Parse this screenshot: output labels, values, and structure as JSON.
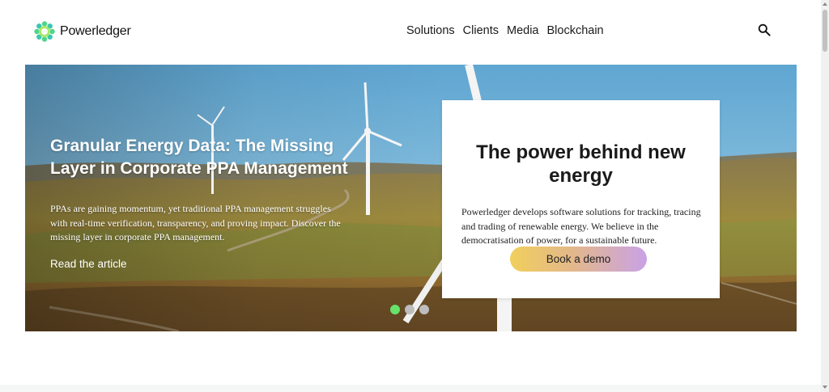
{
  "header": {
    "logo_text": "Powerledger",
    "nav": [
      "Solutions",
      "Clients",
      "Media",
      "Blockchain"
    ],
    "search_icon": "search-icon"
  },
  "hero": {
    "title": "Granular Energy Data: The Missing Layer in Corporate PPA Management",
    "description": "PPAs are gaining momentum, yet traditional PPA management struggles with real-time verification, transparency, and proving impact. Discover the missing layer in corporate PPA management.",
    "link_label": "Read the article",
    "slides_total": 3,
    "active_slide": 1
  },
  "card": {
    "title": "The power behind new energy",
    "description": "Powerledger develops software solutions for tracking, tracing and trading of renewable energy. We believe in the democratisation of power, for a sustainable future.",
    "cta_label": "Book a demo"
  },
  "colors": {
    "accent_green": "#66e36a",
    "cta_gradient_start": "#f1cf5c",
    "cta_gradient_end": "#c9a2e6"
  }
}
